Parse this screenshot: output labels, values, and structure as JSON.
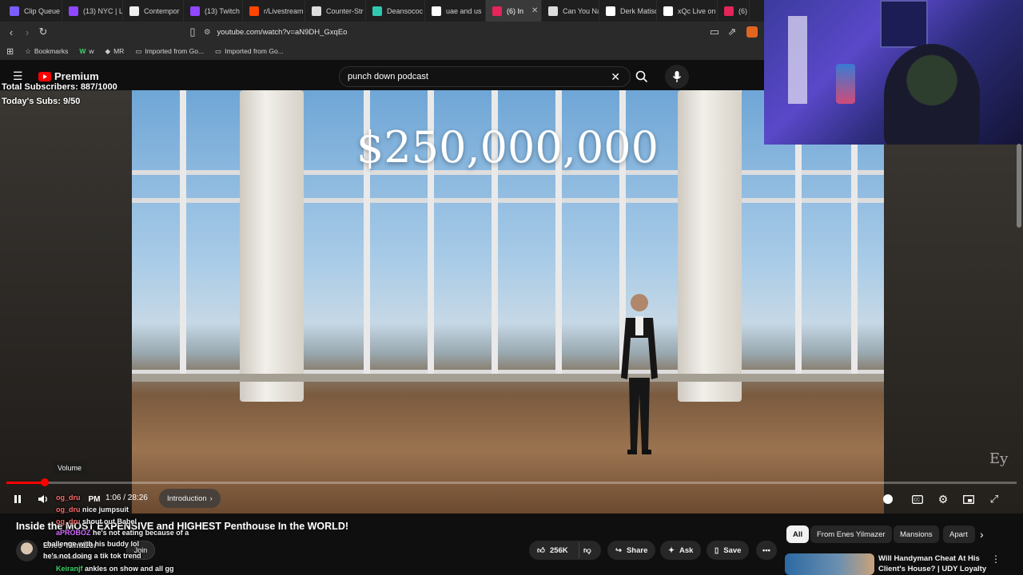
{
  "tabs": [
    {
      "label": "Clip Queue",
      "color": "#7b5cff"
    },
    {
      "label": "(13) NYC | L",
      "color": "#9146ff"
    },
    {
      "label": "Contempor",
      "color": "#eeeeee"
    },
    {
      "label": "(13) Twitch",
      "color": "#9146ff"
    },
    {
      "label": "r/Livestream",
      "color": "#ff4500"
    },
    {
      "label": "Counter-Str",
      "color": "#dddddd"
    },
    {
      "label": "Deansococ",
      "color": "#30c9b0"
    },
    {
      "label": "uae and us",
      "color": "#ffffff"
    },
    {
      "label": "(6) In",
      "color": "#e5245a"
    },
    {
      "label": "Can You Na",
      "color": "#dddddd"
    },
    {
      "label": "Derk Matiso",
      "color": "#ffffff"
    },
    {
      "label": "xQc Live on",
      "color": "#ffffff"
    },
    {
      "label": "(6) Ri",
      "color": "#e5245a"
    }
  ],
  "address": {
    "url": "youtube.com/watch?v=aN9DH_GxqEo"
  },
  "bookmarks": [
    "Bookmarks",
    "w",
    "MR",
    "Imported from Go...",
    "Imported from Go..."
  ],
  "header": {
    "logo": "Premium",
    "search_value": "punch down podcast"
  },
  "overlay": {
    "total_subs": "Total Subscribers: 887/1000",
    "today_subs": "Today's Subs: 9/50"
  },
  "video": {
    "price_text": "$250,000,000",
    "watermark": "Ey",
    "progress": 0.0376
  },
  "controls": {
    "volume_tooltip": "Volume",
    "time": "1:06 / 28:26",
    "chapter": "Introduction",
    "pm": "PM"
  },
  "video_title": "Inside the MOST EXPENSIVE and HIGHEST Penthouse In the WORLD!",
  "channel": {
    "name": "Enes Yilmazer",
    "subs": "4.19M subscribers",
    "join": "Join"
  },
  "actions": {
    "likes": "256K",
    "share": "Share",
    "ask": "Ask",
    "save": "Save"
  },
  "chat": [
    {
      "user": "og_dru",
      "text": "",
      "color": "#ff6b6b"
    },
    {
      "user": "og_dru",
      "text": "nice jumpsuit",
      "color": "#ff6b6b"
    },
    {
      "user": "og_dru",
      "text": "shout out Babel",
      "color": "#ff6b6b"
    },
    {
      "user": "aPROBOZ",
      "text": "he's not eating because of a",
      "color": "#d36bff"
    },
    {
      "user": "",
      "text": "challenge with his buddy lol",
      "color": "#ffffff"
    },
    {
      "user": "",
      "text": "he's not doing a tik tok trend",
      "color": "#ffffff"
    },
    {
      "user": "Keiranjf",
      "text": "ankles on show and all gg",
      "color": "#3fd36a"
    }
  ],
  "chips": [
    "All",
    "From Enes Yilmazer",
    "Mansions",
    "Apart"
  ],
  "recommendation": {
    "title": "Will Handyman Cheat At His Client's House? | UDY Loyalty ..."
  }
}
